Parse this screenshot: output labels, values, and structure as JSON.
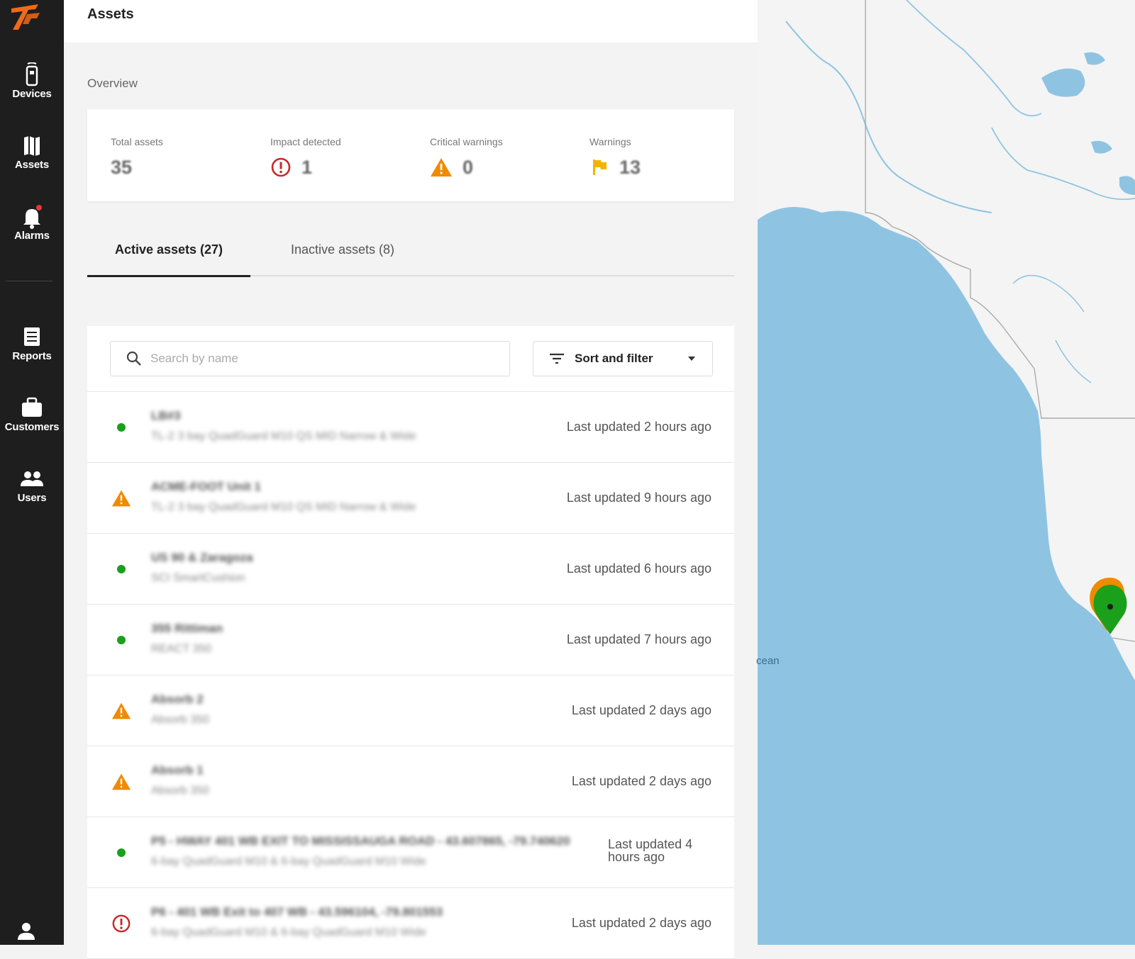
{
  "nav": {
    "items": [
      {
        "label": "Devices",
        "icon": "device-icon"
      },
      {
        "label": "Assets",
        "icon": "map-icon"
      },
      {
        "label": "Alarms",
        "icon": "bell-icon"
      },
      {
        "label": "Reports",
        "icon": "report-icon"
      },
      {
        "label": "Customers",
        "icon": "briefcase-icon"
      },
      {
        "label": "Users",
        "icon": "users-icon"
      }
    ]
  },
  "header": {
    "title": "Assets"
  },
  "overview": {
    "title": "Overview",
    "stats": [
      {
        "label": "Total assets",
        "value": "35"
      },
      {
        "label": "Impact detected",
        "value": "1",
        "icon": "impact-icon"
      },
      {
        "label": "Critical warnings",
        "value": "0",
        "icon": "warning-triangle-icon"
      },
      {
        "label": "Warnings",
        "value": "13",
        "icon": "flag-icon"
      }
    ]
  },
  "tabs": {
    "active": "Active assets (27)",
    "inactive": "Inactive assets (8)"
  },
  "search": {
    "placeholder": "Search by name",
    "value": ""
  },
  "sort": {
    "label": "Sort and filter"
  },
  "assets": [
    {
      "status": "ok",
      "name": "LB#3",
      "model": "TL-2 3 bay QuadGuard M10 QS MID Narrow & Wide",
      "updated": "Last updated 2 hours ago"
    },
    {
      "status": "warning",
      "name": "ACME-FOOT Unit 1",
      "model": "TL-2 3 bay QuadGuard M10 QS MID Narrow & Wide",
      "updated": "Last updated 9 hours ago"
    },
    {
      "status": "ok",
      "name": "US 90 & Zaragoza",
      "model": "SCI SmartCushion",
      "updated": "Last updated 6 hours ago"
    },
    {
      "status": "ok",
      "name": "355 Rittiman",
      "model": "REACT 350",
      "updated": "Last updated 7 hours ago"
    },
    {
      "status": "warning",
      "name": "Absorb 2",
      "model": "Absorb 350",
      "updated": "Last updated 2 days ago"
    },
    {
      "status": "warning",
      "name": "Absorb 1",
      "model": "Absorb 350",
      "updated": "Last updated 2 days ago"
    },
    {
      "status": "ok",
      "name": "P5 - HWAY 401 WB EXIT TO MISSISSAUGA ROAD - 43.607865, -79.740620",
      "model": "6-bay QuadGuard M10 & 6-bay QuadGuard M10 Wide",
      "updated": "Last updated 4 hours ago"
    },
    {
      "status": "impact",
      "name": "P6 - 401 WB Exit to 407 WB - 43.596104, -79.801553",
      "model": "6-bay QuadGuard M10 & 6-bay QuadGuard M10 Wide",
      "updated": "Last updated 2 days ago"
    }
  ],
  "map": {
    "ocean_label": "cean",
    "water_color": "#8ec4e2",
    "land_color": "#f4f4f4"
  },
  "colors": {
    "sidebar": "#1e1e1e",
    "ok": "#1aa01a",
    "warning": "#f08a00",
    "impact": "#c62828",
    "flag": "#f2b400"
  }
}
